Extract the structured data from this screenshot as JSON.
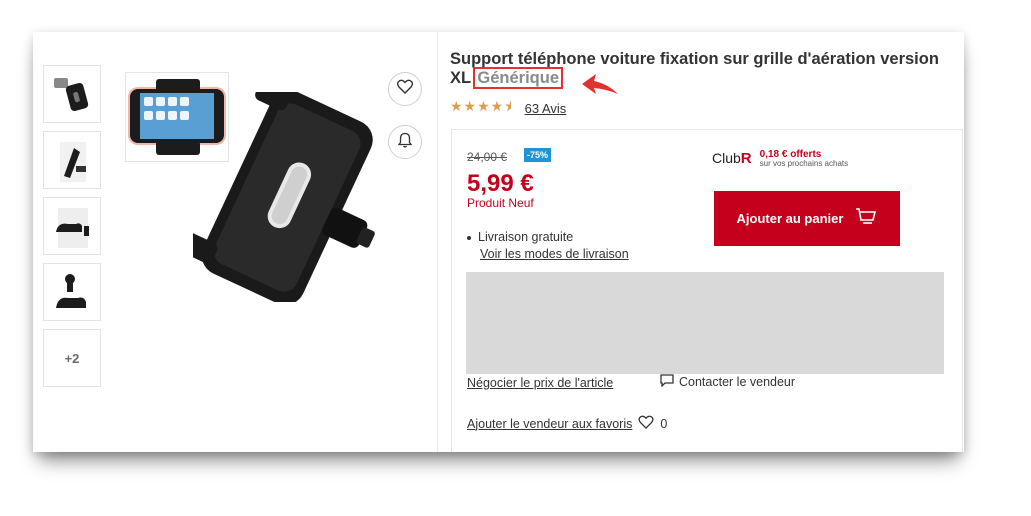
{
  "product": {
    "title": "Support téléphone voiture fixation sur grille d'aération version XL",
    "brand": "Générique",
    "rating_stars": "★★★★⯨",
    "reviews": "63 Avis"
  },
  "gallery": {
    "more_label": "+2"
  },
  "pricing": {
    "old_price": "24,00 €",
    "discount": "-75%",
    "price": "5,99 €",
    "condition": "Produit Neuf"
  },
  "club": {
    "logo_text": "Club",
    "logo_letter": "R",
    "offer_amount": "0,18 € offerts",
    "offer_sub": "sur vos prochains achats"
  },
  "actions": {
    "add_to_cart": "Ajouter au panier",
    "delivery": "Livraison gratuite",
    "delivery_link": "Voir les modes de livraison",
    "negotiate": "Négocier le prix de l'article",
    "contact": "Contacter le vendeur",
    "favorite": "Ajouter le vendeur aux favoris",
    "favorite_count": "0"
  },
  "colors": {
    "accent": "#c4001d",
    "discount_badge": "#1e96d6",
    "stars": "#d99e4f",
    "highlight": "#e0322f"
  },
  "icons": [
    "heart-icon",
    "bell-icon",
    "cart-icon",
    "chat-icon",
    "arrow-annotation-icon"
  ]
}
